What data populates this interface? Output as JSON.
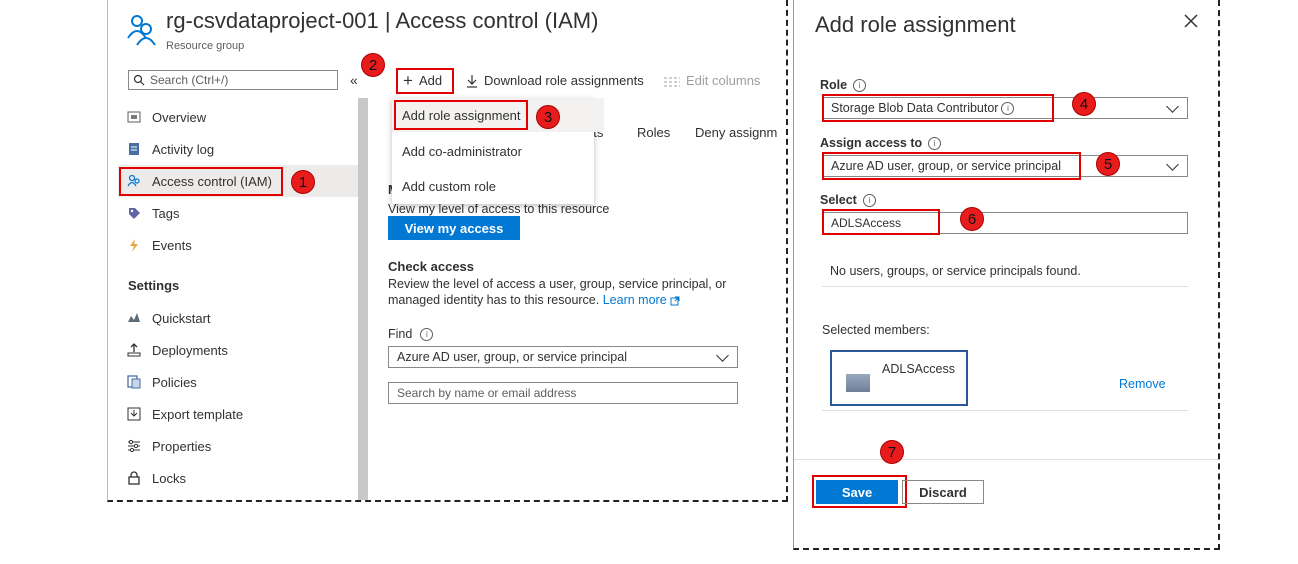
{
  "left": {
    "title": "rg-csvdataproject-001 | Access control (IAM)",
    "subtitle": "Resource group",
    "search_placeholder": "Search (Ctrl+/)",
    "collapse_glyph": "«",
    "nav": [
      {
        "label": "Overview",
        "icon": "overview-icon"
      },
      {
        "label": "Activity log",
        "icon": "activity-log-icon"
      },
      {
        "label": "Access control (IAM)",
        "icon": "iam-icon"
      },
      {
        "label": "Tags",
        "icon": "tag-icon"
      },
      {
        "label": "Events",
        "icon": "events-icon"
      }
    ],
    "settings_heading": "Settings",
    "settings_nav": [
      {
        "label": "Quickstart",
        "icon": "quickstart-icon"
      },
      {
        "label": "Deployments",
        "icon": "deployments-icon"
      },
      {
        "label": "Policies",
        "icon": "policies-icon"
      },
      {
        "label": "Export template",
        "icon": "export-template-icon"
      },
      {
        "label": "Properties",
        "icon": "properties-icon"
      },
      {
        "label": "Locks",
        "icon": "lock-icon"
      }
    ],
    "toolbar": {
      "add": "Add",
      "download": "Download role assignments",
      "edit_columns": "Edit columns"
    },
    "add_menu": [
      "Add role assignment",
      "Add co-administrator",
      "Add custom role"
    ],
    "tabs": [
      "nts",
      "Roles",
      "Deny assignm"
    ],
    "my_access": {
      "heading_fragment": "M",
      "text": "View my level of access to this resource",
      "button": "View my access"
    },
    "check_access": {
      "heading": "Check access",
      "text1": "Review the level of access a user, group, service principal, or",
      "text2": "managed identity has to this resource.",
      "learn_more": "Learn more",
      "find_label": "Find",
      "find_value": "Azure AD user, group, or service principal",
      "search_placeholder": "Search by name or email address"
    }
  },
  "right": {
    "title": "Add role assignment",
    "role_label": "Role",
    "role_value": "Storage Blob Data Contributor",
    "assign_label": "Assign access to",
    "assign_value": "Azure AD user, group, or service principal",
    "select_label": "Select",
    "select_value": "ADLSAccess",
    "no_results": "No users, groups, or service principals found.",
    "selected_members_label": "Selected members:",
    "member_name": "ADLSAccess",
    "remove": "Remove",
    "save": "Save",
    "discard": "Discard"
  },
  "badges": [
    "1",
    "2",
    "3",
    "4",
    "5",
    "6",
    "7"
  ],
  "colors": {
    "accent": "#0078d4",
    "highlight": "#e00000",
    "badge": "#e81c1c",
    "member_box": "#2b5797"
  }
}
